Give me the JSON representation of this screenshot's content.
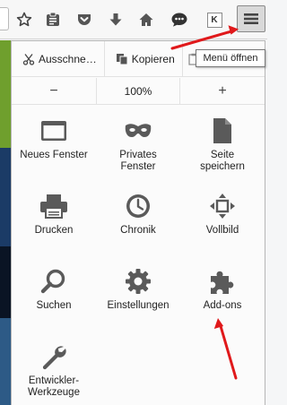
{
  "toolbar": {
    "icons": [
      "star-icon",
      "reading-list-icon",
      "pocket-icon",
      "download-icon",
      "home-icon",
      "chat-icon",
      "k-extension-icon",
      "hamburger-menu-icon"
    ],
    "k_icon_letter": "K"
  },
  "tooltip": {
    "text": "Menü öffnen"
  },
  "edit_row": {
    "cut": "Ausschne…",
    "copy": "Kopieren"
  },
  "zoom": {
    "minus": "−",
    "level": "100%",
    "plus": "+"
  },
  "menu_items": [
    {
      "label": "Neues Fenster",
      "icon": "window-icon"
    },
    {
      "label": "Privates Fenster",
      "icon": "private-mask-icon"
    },
    {
      "label": "Seite speichern",
      "icon": "save-page-icon"
    },
    {
      "label": "Drucken",
      "icon": "print-icon"
    },
    {
      "label": "Chronik",
      "icon": "history-clock-icon"
    },
    {
      "label": "Vollbild",
      "icon": "fullscreen-icon"
    },
    {
      "label": "Suchen",
      "icon": "search-icon"
    },
    {
      "label": "Einstellungen",
      "icon": "gear-icon"
    },
    {
      "label": "Add-ons",
      "icon": "puzzle-icon"
    },
    {
      "label": "Entwickler-Werkzeuge",
      "icon": "wrench-icon"
    }
  ],
  "colors": {
    "icon_gray": "#5a5a5a",
    "annotation_red": "#e0191b"
  }
}
